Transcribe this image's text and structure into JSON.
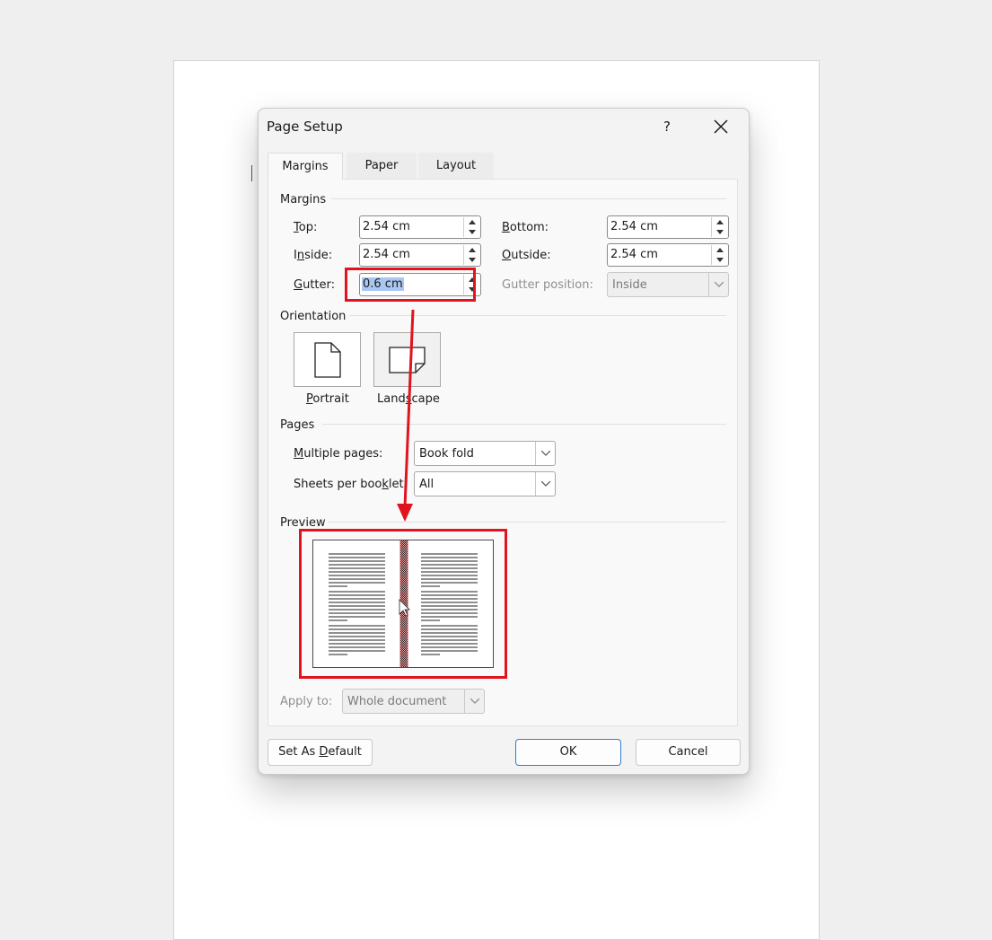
{
  "dialog": {
    "title": "Page Setup",
    "help_label": "?",
    "tabs": [
      {
        "label": "Margins",
        "active": true
      },
      {
        "label": "Paper",
        "active": false
      },
      {
        "label": "Layout",
        "active": false
      }
    ]
  },
  "margins": {
    "group_label": "Margins",
    "top": {
      "label_u": "T",
      "label_rest": "op:",
      "value": "2.54 cm"
    },
    "bottom": {
      "label_u": "B",
      "label_rest": "ottom:",
      "value": "2.54 cm"
    },
    "inside": {
      "label_pre": "I",
      "label_u": "n",
      "label_rest": "side:",
      "value": "2.54 cm"
    },
    "outside": {
      "label_u": "O",
      "label_rest": "utside:",
      "value": "2.54 cm"
    },
    "gutter": {
      "label_u": "G",
      "label_rest": "utter:",
      "value": "0.6 cm"
    },
    "gutter_position": {
      "label": "Gutter position:",
      "value": "Inside"
    }
  },
  "orientation": {
    "group_label": "Orientation",
    "portrait_label_u": "P",
    "portrait_label_rest": "ortrait",
    "landscape_label_pre": "Land",
    "landscape_label_u": "s",
    "landscape_label_rest": "cape"
  },
  "pages": {
    "group_label": "Pages",
    "multiple_pages_label_u": "M",
    "multiple_pages_label_rest": "ultiple pages:",
    "multiple_pages_value": "Book fold",
    "sheets_label_pre": "Sheets per boo",
    "sheets_label_u": "k",
    "sheets_label_rest": "let:",
    "sheets_value": "All"
  },
  "preview": {
    "group_label": "Preview"
  },
  "apply_to": {
    "label": "Apply to:",
    "value": "Whole document"
  },
  "buttons": {
    "set_default_pre": "Set As ",
    "set_default_u": "D",
    "set_default_rest": "efault",
    "ok": "OK",
    "cancel": "Cancel"
  },
  "colors": {
    "highlight": "#e0141e",
    "gutter_fill": "#f5a3a6",
    "selection": "#a9c7f0",
    "ok_border": "#2f7fd0"
  },
  "icons": [
    "help-icon",
    "close-icon",
    "spin-up-icon",
    "spin-down-icon",
    "chevron-down-icon",
    "portrait-page-icon",
    "landscape-page-icon",
    "mouse-cursor-icon"
  ]
}
